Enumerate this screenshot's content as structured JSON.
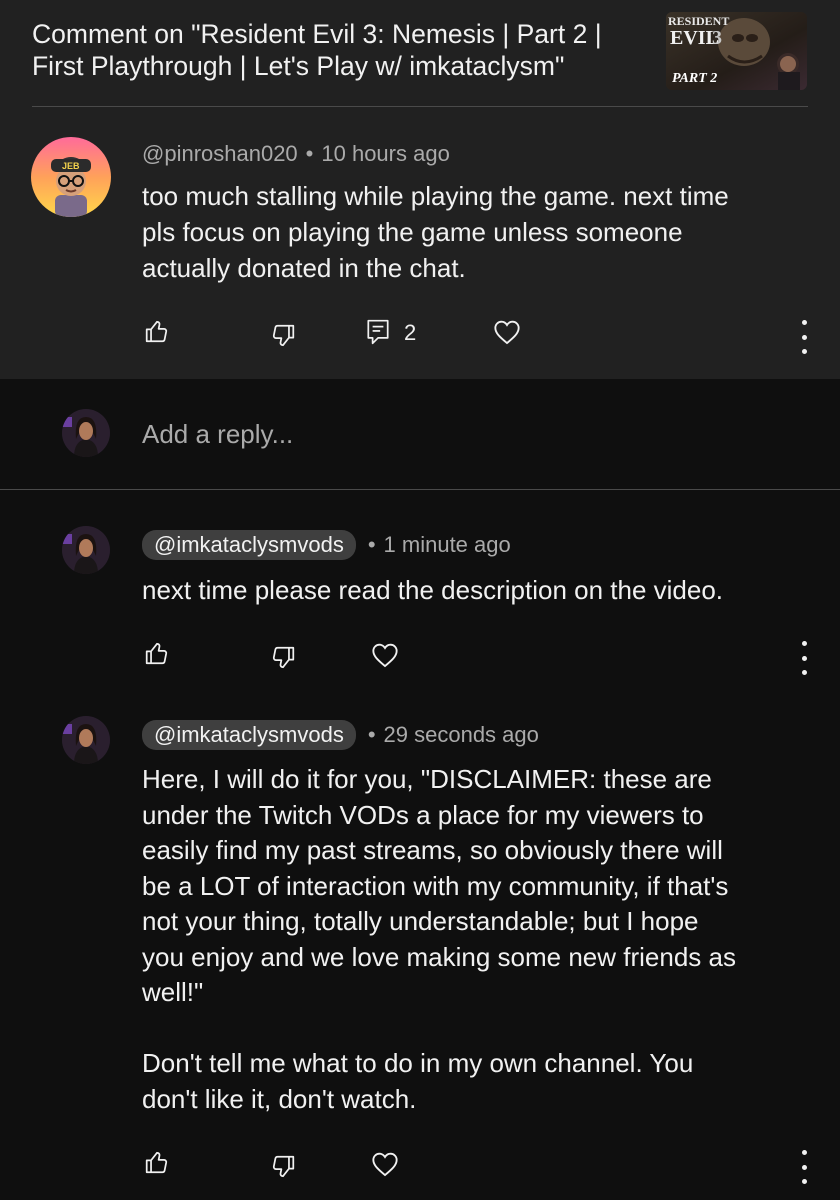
{
  "header": {
    "title": "Comment on \"Resident Evil 3: Nemesis | Part 2 |\nFirst Playthrough | Let's Play w/ imkataclysm\"",
    "thumbnail": {
      "logo_text": "RESIDENT EVIL 3",
      "part_text": "PART 2"
    }
  },
  "parent_comment": {
    "author": "@pinroshan020",
    "time": "10 hours ago",
    "text": "too much stalling while playing the game. next time\npls focus on playing the game unless someone\nactually donated in the chat.",
    "reply_count": "2",
    "avatar_badge": "JEB"
  },
  "reply_input": {
    "placeholder": "Add a reply..."
  },
  "replies": [
    {
      "author": "@imkataclysmvods",
      "time": "1 minute ago",
      "text": "next time please read the description on the video."
    },
    {
      "author": "@imkataclysmvods",
      "time": "29 seconds ago",
      "text": "Here, I will do it for you, \"DISCLAIMER: these are\nunder the Twitch VODs a place for my viewers to\neasily find my past streams, so obviously there will\nbe a LOT of interaction with my community, if that's\nnot your thing, totally understandable; but I hope\nyou enjoy and we love making some new friends as\nwell!\"\n\nDon't tell me what to do in my own channel. You\ndon't like it, don't watch."
    }
  ],
  "icons": {
    "like": "thumbs-up-icon",
    "dislike": "thumbs-down-icon",
    "reply": "comment-icon",
    "heart": "heart-icon",
    "more": "more-vertical-icon"
  },
  "colors": {
    "background": "#0f0f0f",
    "panel": "#212121",
    "text": "#f1f1f1",
    "secondary_text": "#aaaaaa",
    "pill": "#3f3f3f"
  }
}
